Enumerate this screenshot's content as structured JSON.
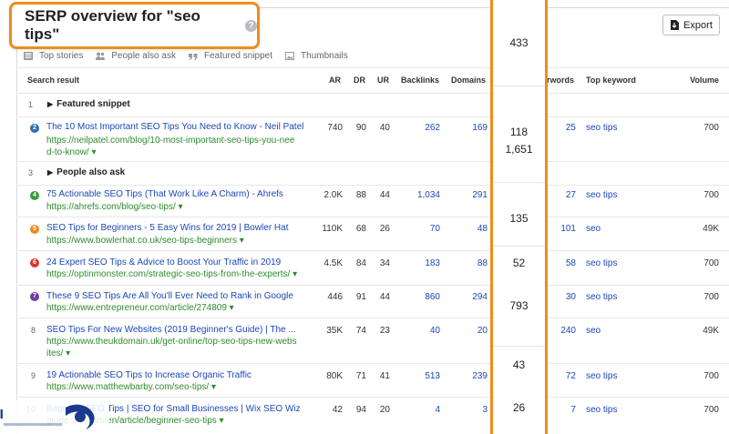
{
  "title": "SERP overview for \"seo tips\"",
  "help_glyph": "?",
  "export_label": "Export",
  "filters": [
    "Top stories",
    "People also ask",
    "Featured snippet",
    "Thumbnails"
  ],
  "columns": {
    "search_result": "Search result",
    "ar": "AR",
    "dr": "DR",
    "ur": "UR",
    "backlinks": "Backlinks",
    "domains": "Domains",
    "keywords": "rwords",
    "top_keyword": "Top keyword",
    "volume": "Volume"
  },
  "groups": [
    {
      "num": "1",
      "label": "Featured snippet"
    },
    {
      "num": "3",
      "label": "People also ask"
    }
  ],
  "rows": [
    {
      "pos": "2",
      "badge_color": "#2d6fb6",
      "title": "The 10 Most Important SEO Tips You Need to Know - Neil Patel",
      "url1": "https://neilpatel.com/blog/10-most-important-seo-tips-you-nee",
      "url2": "d-to-know/",
      "ar": "740",
      "dr": "90",
      "ur": "40",
      "backlinks": "262",
      "domains": "169",
      "keywords": "25",
      "top_keyword": "seo tips",
      "volume": "700"
    },
    {
      "pos": "4",
      "badge_color": "#3a9c3a",
      "title": "75 Actionable SEO Tips (That Work Like A Charm) - Ahrefs",
      "url1": "https://ahrefs.com/blog/seo-tips/",
      "ar": "2.0K",
      "dr": "88",
      "ur": "44",
      "backlinks": "1,034",
      "domains": "291",
      "keywords": "27",
      "top_keyword": "seo tips",
      "volume": "700"
    },
    {
      "pos": "5",
      "badge_color": "#ef8a24",
      "title": "SEO Tips for Beginners - 5 Easy Wins for 2019 | Bowler Hat",
      "url1": "https://www.bowlerhat.co.uk/seo-tips-beginners",
      "ar": "110K",
      "dr": "68",
      "ur": "26",
      "backlinks": "70",
      "domains": "48",
      "keywords": "101",
      "top_keyword": "seo",
      "volume": "49K"
    },
    {
      "pos": "6",
      "badge_color": "#d8372f",
      "title": "24 Expert SEO Tips & Advice to Boost Your Traffic in 2019",
      "url1": "https://optinmonster.com/strategic-seo-tips-from-the-experts/",
      "ar": "4.5K",
      "dr": "84",
      "ur": "34",
      "backlinks": "183",
      "domains": "88",
      "keywords": "58",
      "top_keyword": "seo tips",
      "volume": "700"
    },
    {
      "pos": "7",
      "badge_color": "#6b3fa0",
      "title": "These 9 SEO Tips Are All You'll Ever Need to Rank in Google",
      "url1": "https://www.entrepreneur.com/article/274809",
      "ar": "446",
      "dr": "91",
      "ur": "44",
      "backlinks": "860",
      "domains": "294",
      "keywords": "30",
      "top_keyword": "seo tips",
      "volume": "700"
    },
    {
      "pos": "8",
      "badge_color": "",
      "title": "SEO Tips For New Websites (2019 Beginner's Guide) | The ...",
      "url1": "https://www.theukdomain.uk/get-online/top-seo-tips-new-webs",
      "url2": "ites/",
      "ar": "35K",
      "dr": "74",
      "ur": "23",
      "backlinks": "40",
      "domains": "20",
      "keywords": "240",
      "top_keyword": "seo",
      "volume": "49K"
    },
    {
      "pos": "9",
      "badge_color": "",
      "title": "19 Actionable SEO Tips to Increase Organic Traffic",
      "url1": "https://www.matthewbarby.com/seo-tips/",
      "ar": "80K",
      "dr": "71",
      "ur": "41",
      "backlinks": "513",
      "domains": "239",
      "keywords": "72",
      "top_keyword": "seo tips",
      "volume": "700"
    },
    {
      "pos": "10",
      "badge_color": "",
      "title": "Beginner SEO Tips | SEO for Small Businesses | Wix SEO Wiz",
      "url1": "https://www.wix.com/seo/learn/article/beginner-seo-tips",
      "url1_visible": "guide.wix.com/en/article/beginner-seo-tips",
      "ar": "42",
      "dr": "94",
      "ur": "20",
      "backlinks": "4",
      "domains": "3",
      "keywords": "7",
      "top_keyword": "seo tips",
      "volume": "700"
    }
  ],
  "highlight_column": [
    "433",
    "118",
    "1,651",
    "135",
    "52",
    "793",
    "43",
    "26"
  ],
  "watermark": "ایرانیکارت"
}
